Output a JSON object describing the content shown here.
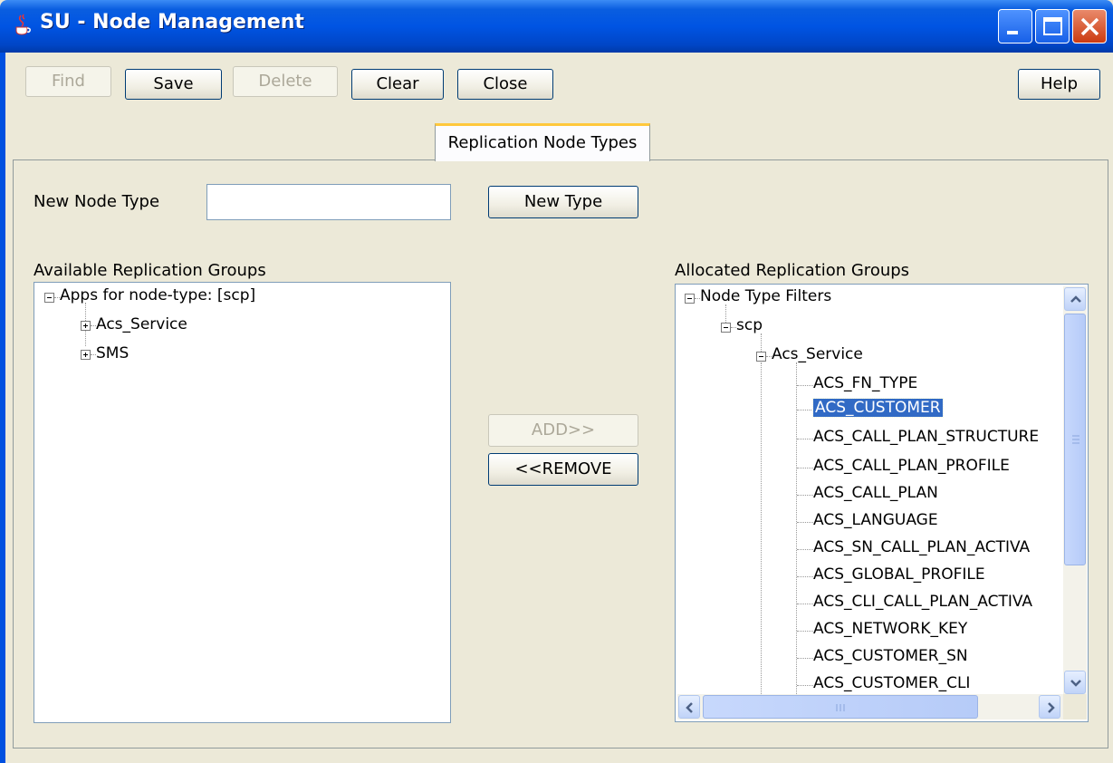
{
  "window": {
    "title": "SU - Node Management"
  },
  "toolbar": {
    "find_label": "Find",
    "save_label": "Save",
    "delete_label": "Delete",
    "clear_label": "Clear",
    "close_label": "Close",
    "help_label": "Help"
  },
  "tabs": [
    {
      "label": "Replication Node Types",
      "active": true
    }
  ],
  "form": {
    "new_node_type_label": "New Node Type",
    "new_node_type_value": "",
    "new_type_button": "New Type",
    "add_button": "ADD>>",
    "remove_button": "<<REMOVE"
  },
  "available": {
    "heading": "Available Replication Groups",
    "root": "Apps for node-type: [scp]",
    "children": [
      "Acs_Service",
      "SMS"
    ]
  },
  "allocated": {
    "heading": "Allocated Replication Groups",
    "root": "Node Type Filters",
    "node": "scp",
    "group": "Acs_Service",
    "items": [
      "ACS_FN_TYPE",
      "ACS_CUSTOMER",
      "ACS_CALL_PLAN_STRUCTURE",
      "ACS_CALL_PLAN_PROFILE",
      "ACS_CALL_PLAN",
      "ACS_LANGUAGE",
      "ACS_SN_CALL_PLAN_ACTIVA",
      "ACS_GLOBAL_PROFILE",
      "ACS_CLI_CALL_PLAN_ACTIVA",
      "ACS_NETWORK_KEY",
      "ACS_CUSTOMER_SN",
      "ACS_CUSTOMER_CLI"
    ],
    "selected_item": "ACS_CUSTOMER"
  },
  "colors": {
    "titlebar": "#0054e3",
    "selection": "#316ac5",
    "window_bg": "#ece9d8"
  }
}
